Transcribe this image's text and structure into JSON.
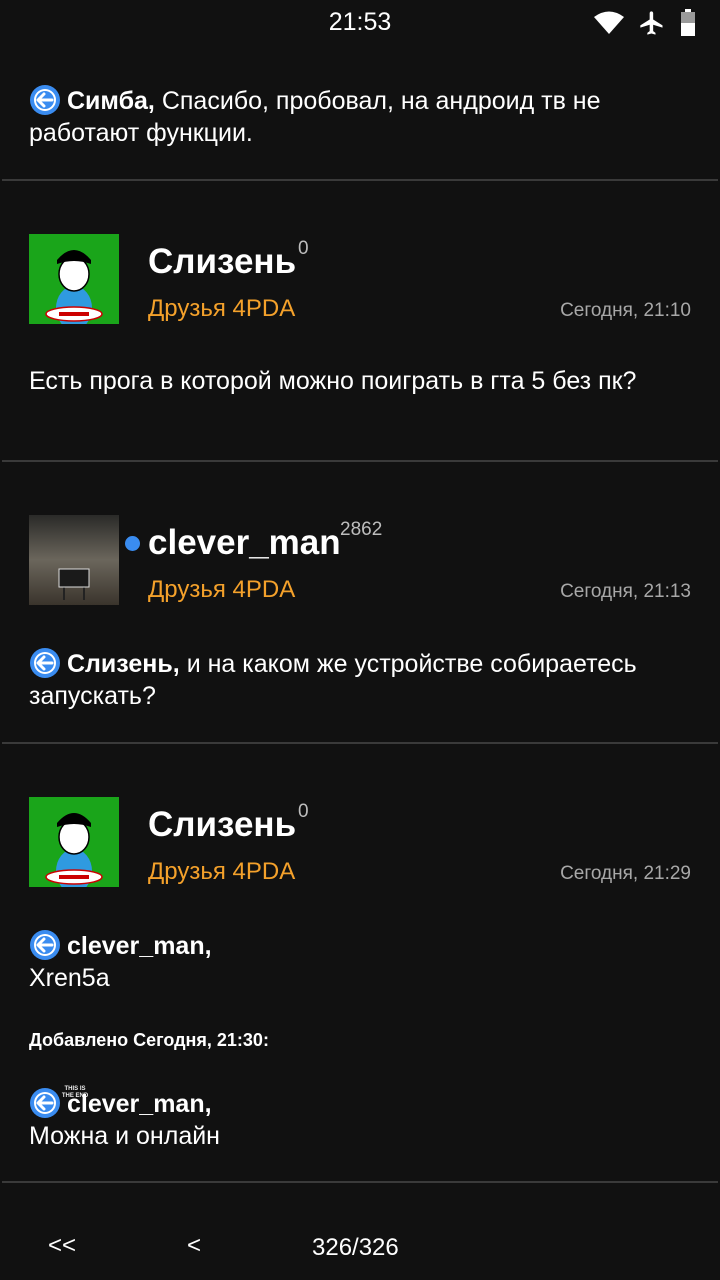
{
  "status_bar": {
    "time": "21:53"
  },
  "posts": [
    {
      "reply_to": "Симба,",
      "text": "Спасибо,  пробовал,  на андроид тв не работают функции."
    },
    {
      "username": "Слизень",
      "reputation": "0",
      "group": "Друзья 4PDA",
      "time": "Сегодня, 21:10",
      "text": "Есть прога в которой можно поиграть в гта 5 без пк?"
    },
    {
      "username": "clever_man",
      "reputation": "2862",
      "group": "Друзья 4PDA",
      "time": "Сегодня, 21:13",
      "online": true,
      "avatar_text": "THIS IS THE END",
      "reply_to": "Слизень,",
      "text": "и на каком же устройстве собираетесь запускать?"
    },
    {
      "username": "Слизень",
      "reputation": "0",
      "group": "Друзья 4PDA",
      "time": "Сегодня, 21:29",
      "reply1_to": "clever_man,",
      "reply1_text": "Xren5a",
      "added_label": "Добавлено Сегодня, 21:30:",
      "reply2_to": "clever_man,",
      "reply2_text": "Можна и онлайн"
    }
  ],
  "pager": {
    "first": "<<",
    "prev": "<",
    "count": "326/326"
  },
  "colors": {
    "background": "#111111",
    "group": "#f4a12b",
    "online": "#3a8cf0",
    "reply_icon": "#3a8cf0"
  }
}
